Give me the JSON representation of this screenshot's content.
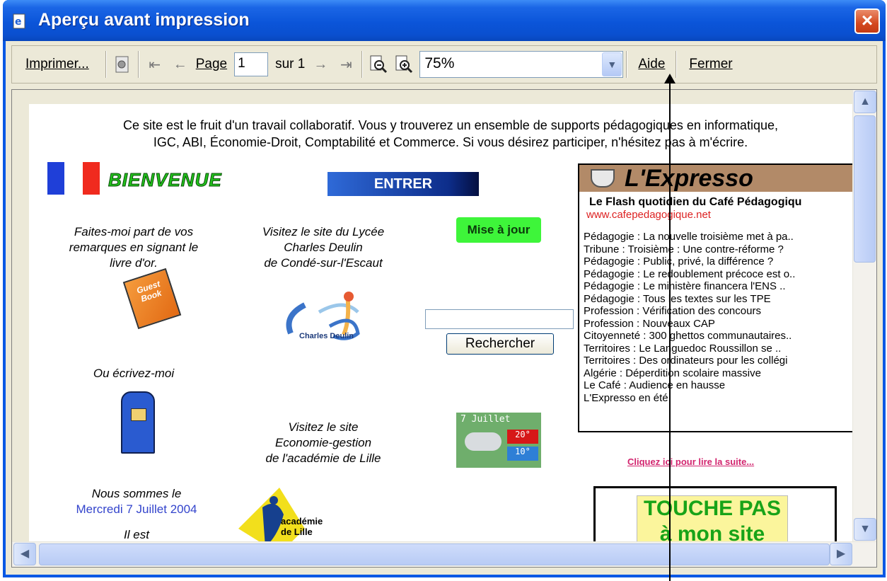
{
  "window": {
    "title": "Aperçu avant impression",
    "close_label": "×"
  },
  "toolbar": {
    "print_label": "Imprimer...",
    "page_label": "Page",
    "page_value": "1",
    "of_label": "sur 1",
    "zoom_value": "75%",
    "help_label": "Aide",
    "close_label": "Fermer"
  },
  "page": {
    "intro_line1": "Ce site est le fruit d'un travail collaboratif. Vous y trouverez un ensemble de supports pédagogiques en informatique,",
    "intro_line2": "IGC, ABI, Économie-Droit, Comptabilité et Commerce. Si vous désirez participer, n'hésitez pas à m'écrire.",
    "bienvenue": "BIENVENUE",
    "entrer": "ENTRER",
    "guestbook_text": [
      "Faites-moi part de vos",
      "remarques en signant le",
      "livre d'or."
    ],
    "book_label": "Guest Book",
    "lycee_text": [
      "Visitez le site du Lycée",
      "Charles Deulin",
      "de Condé-sur-l'Escaut"
    ],
    "deulin_logo_text": "Charles Deulin",
    "mise_a_jour": "Mise à jour",
    "search_button": "Rechercher",
    "write_me": "Ou écrivez-moi",
    "eco_text": [
      "Visitez le site",
      "Economie-gestion",
      "de l'académie de Lille"
    ],
    "date_intro": "Nous sommes le",
    "date_value": "Mercredi 7 Juillet 2004",
    "time_intro": "Il est",
    "weather": {
      "date": "7 Juillet",
      "tmax": "20°",
      "tmin": "10°"
    },
    "academie_text": [
      "académie",
      "de Lille"
    ],
    "expresso": {
      "title": "L'Expresso",
      "subtitle": "Le Flash quotidien du Café Pédagogiqu",
      "url": "www.cafepedagogique.net",
      "items": [
        "Pédagogie : La nouvelle troisième met à pa..",
        "Tribune : Troisième : Une contre-réforme ?",
        "Pédagogie : Public, privé, la différence ?",
        "Pédagogie : Le redoublement précoce est o..",
        "Pédagogie : Le ministère financera l'ENS ..",
        "Pédagogie : Tous les textes sur les TPE",
        "Profession : Vérification des concours",
        "Profession : Nouveaux CAP",
        "Citoyenneté : 300 ghettos communautaires..",
        "Territoires : Le Languedoc Roussillon se ..",
        "Territoires : Des ordinateurs pour les collégi",
        "Algérie : Déperdition scolaire massive",
        "Le Café : Audience en hausse",
        "L'Expresso en été"
      ]
    },
    "cliquez": "Cliquez ici pour lire la suite...",
    "touche_lines": [
      "TOUCHE PAS",
      "à mon site"
    ]
  }
}
